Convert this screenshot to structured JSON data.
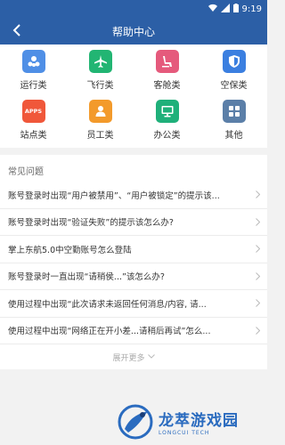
{
  "status_bar": {
    "time": "9:19"
  },
  "header": {
    "title": "帮助中心"
  },
  "categories": [
    {
      "label": "运行类",
      "icon": "sitemap-icon",
      "color": "#4f8fe6"
    },
    {
      "label": "飞行类",
      "icon": "airplane-icon",
      "color": "#22b573"
    },
    {
      "label": "客舱类",
      "icon": "seat-icon",
      "color": "#e55a7c"
    },
    {
      "label": "空保类",
      "icon": "shield-icon",
      "color": "#3b7fe0"
    },
    {
      "label": "站点类",
      "icon": "apps-icon",
      "icon_text": "APPS",
      "color": "#f0573a"
    },
    {
      "label": "员工类",
      "icon": "person-icon",
      "color": "#f39a2b"
    },
    {
      "label": "办公类",
      "icon": "monitor-icon",
      "color": "#1fb07a"
    },
    {
      "label": "其他",
      "icon": "grid-icon",
      "color": "#5b7fa8"
    }
  ],
  "faq": {
    "title": "常见问题",
    "items": [
      "账号登录时出现“用户被禁用”、“用户被锁定”的提示该...",
      "账号登录时出现“验证失败”的提示该怎么办?",
      "掌上东航5.0中空勤账号怎么登陆",
      "账号登录时一直出现“请稍侯...”该怎么办?",
      "使用过程中出现“此次请求未返回任何消息/内容, 请...",
      "使用过程中出现“网络正在开小差...请稍后再试”怎么..."
    ],
    "expand_label": "展开更多"
  },
  "watermark": {
    "main": "龙萃游戏园",
    "sub": "LONGCUI TECH"
  }
}
